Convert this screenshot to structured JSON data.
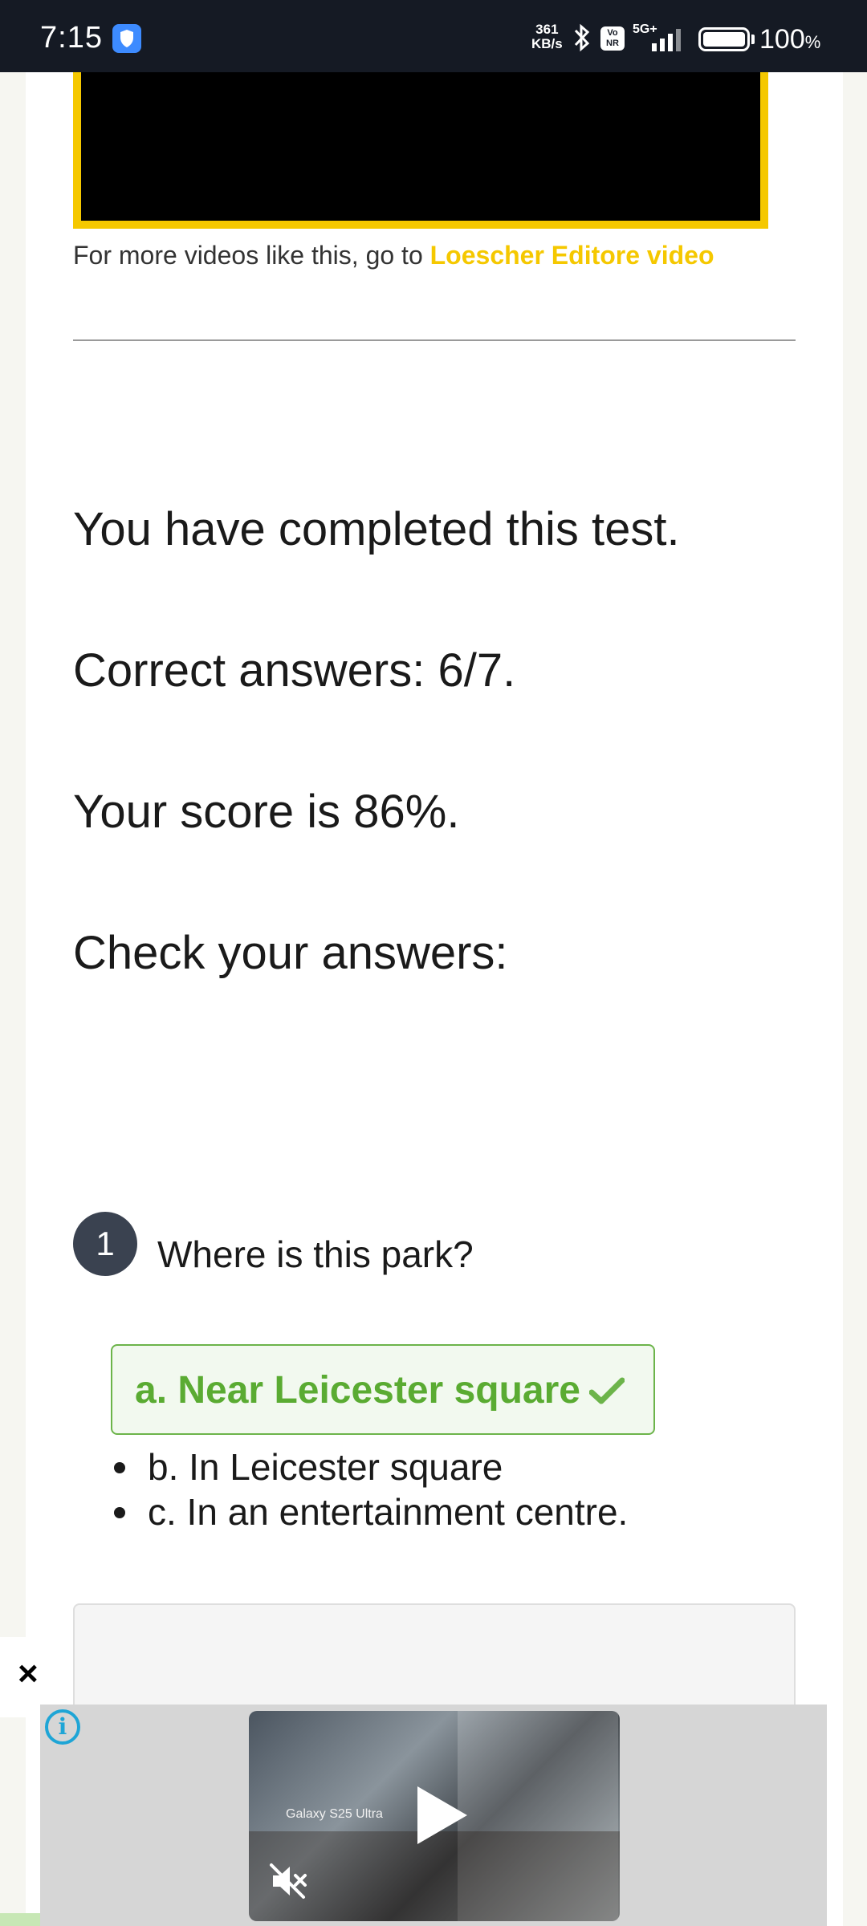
{
  "status_bar": {
    "time": "7:15",
    "net_speed_value": "361",
    "net_speed_unit": "KB/s",
    "volte": "Vo NR",
    "network": "5G+",
    "battery": "100",
    "battery_unit": "%"
  },
  "video": {
    "credit_prefix": "For more videos like this, go to ",
    "credit_link": "Loescher Editore video"
  },
  "results": {
    "completed": "You have completed this test.",
    "correct": "Correct answers: 6/7.",
    "score": "Your score is 86%.",
    "check": "Check your answers:"
  },
  "question": {
    "number": "1",
    "text": "Where is this park?",
    "correct_answer": "a. Near Leicester square",
    "other_answers": [
      "b. In Leicester square",
      "c. In an entertainment centre."
    ]
  },
  "ad": {
    "close": "×",
    "info": "i",
    "brand": "Galaxy S25 Ultra"
  },
  "colors": {
    "accent_yellow": "#f5c800",
    "correct_green": "#5aab32",
    "badge_dark": "#3a4250"
  }
}
